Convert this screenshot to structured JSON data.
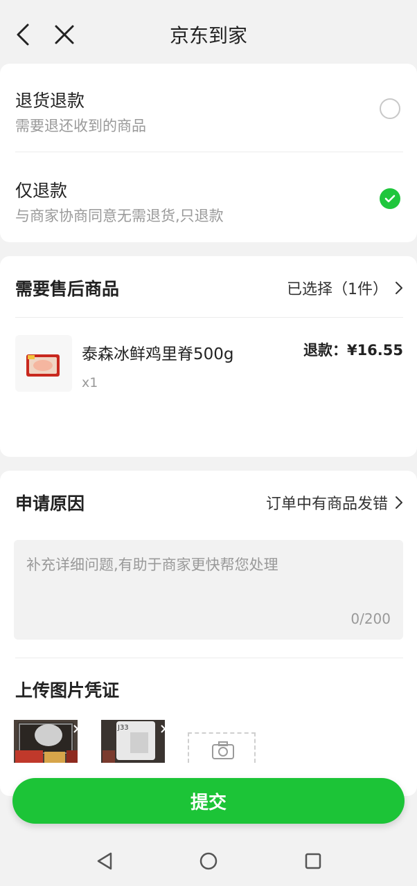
{
  "header": {
    "title": "京东到家"
  },
  "refund_types": [
    {
      "label": "退货退款",
      "desc": "需要退还收到的商品",
      "selected": false
    },
    {
      "label": "仅退款",
      "desc": "与商家协商同意无需退货,只退款",
      "selected": true
    }
  ],
  "goods_section": {
    "title": "需要售后商品",
    "selected_text": "已选择（1件）",
    "product": {
      "name": "泰森冰鲜鸡里脊500g",
      "qty": "x1",
      "refund": "退款：¥16.55"
    }
  },
  "reason_section": {
    "title": "申请原因",
    "value": "订单中有商品发错",
    "placeholder": "补充详细问题,有助于商家更快帮您处理",
    "counter": "0/200"
  },
  "upload_section": {
    "title": "上传图片凭证",
    "photo_2_label": "J33"
  },
  "submit_label": "提交",
  "colors": {
    "accent": "#1cc437",
    "check": "#1fc63c"
  }
}
